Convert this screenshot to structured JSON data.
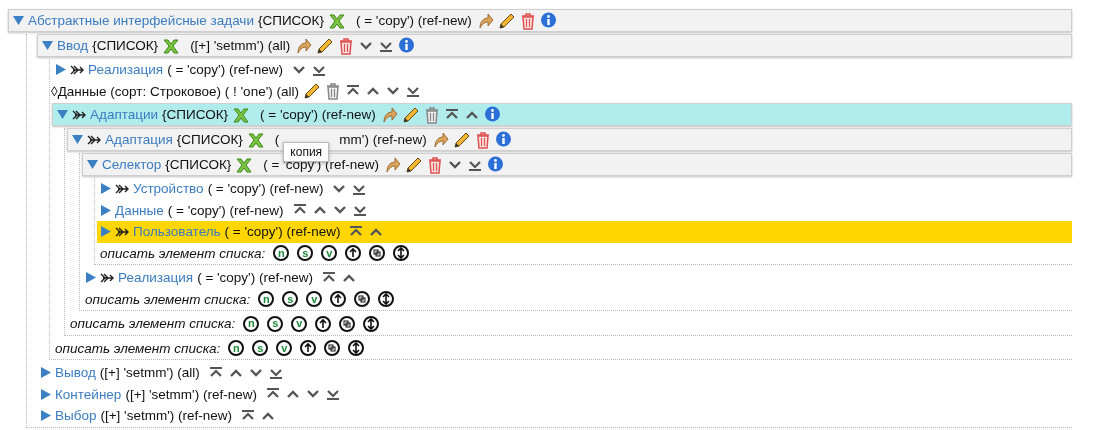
{
  "tree": {
    "kind": "list",
    "expanded": true,
    "linked": false,
    "name": "Абстрактные интерфейсные задачи",
    "tag": "{СПИСОК}",
    "qualifier": "( = 'copy') (ref-new)",
    "icons": [
      {
        "kind": "undo"
      },
      {
        "kind": "edit"
      },
      {
        "kind": "delete"
      },
      {
        "kind": "info"
      }
    ],
    "children": [
      {
        "kind": "list",
        "expanded": true,
        "linked": false,
        "name": "Ввод",
        "tag": "{СПИСОК}",
        "qualifier": "([+] 'setmm') (all)",
        "icons": [
          {
            "kind": "undo"
          },
          {
            "kind": "edit"
          },
          {
            "kind": "delete"
          },
          {
            "kind": "down"
          },
          {
            "kind": "bottom"
          },
          {
            "kind": "info"
          }
        ],
        "children": [
          {
            "kind": "item",
            "expanded": false,
            "linked": true,
            "name": "Реализация",
            "qualifier": "( = 'copy') (ref-new)",
            "icons": [
              {
                "kind": "down"
              },
              {
                "kind": "bottom"
              }
            ]
          },
          {
            "kind": "field",
            "marker": "◊",
            "name": "Данные (сорт: Строковое) ( ! 'one') (all)",
            "icons": [
              {
                "kind": "edit"
              },
              {
                "kind": "delete-off"
              },
              {
                "kind": "top"
              },
              {
                "kind": "up"
              },
              {
                "kind": "down"
              },
              {
                "kind": "bottom"
              }
            ]
          },
          {
            "kind": "list",
            "expanded": true,
            "linked": true,
            "color": "#b0ecec",
            "name": "Адаптации",
            "tag": "{СПИСОК}",
            "qualifier": "( = 'copy') (ref-new)",
            "icons": [
              {
                "kind": "undo"
              },
              {
                "kind": "edit"
              },
              {
                "kind": "delete-off"
              },
              {
                "kind": "top"
              },
              {
                "kind": "up"
              },
              {
                "kind": "info"
              }
            ],
            "children": [
              {
                "kind": "list",
                "expanded": true,
                "linked": true,
                "name": "Адаптация",
                "tag": "{СПИСОК}",
                "qualifier": "(",
                "qualifier_tail": "mm') (ref-new)",
                "tooltip": "копия",
                "icons": [
                  {
                    "kind": "undo"
                  },
                  {
                    "kind": "edit"
                  },
                  {
                    "kind": "delete"
                  },
                  {
                    "kind": "info"
                  }
                ],
                "children": [
                  {
                    "kind": "list",
                    "expanded": true,
                    "linked": false,
                    "name": "Селектор",
                    "tag": "{СПИСОК}",
                    "qualifier": "( = 'copy') (ref-new)",
                    "icons": [
                      {
                        "kind": "undo"
                      },
                      {
                        "kind": "edit"
                      },
                      {
                        "kind": "delete"
                      },
                      {
                        "kind": "down"
                      },
                      {
                        "kind": "bottom"
                      },
                      {
                        "kind": "info"
                      }
                    ],
                    "children": [
                      {
                        "kind": "item",
                        "expanded": false,
                        "linked": true,
                        "name": "Устройство",
                        "qualifier": "( = 'copy') (ref-new)",
                        "icons": [
                          {
                            "kind": "down"
                          },
                          {
                            "kind": "bottom"
                          }
                        ]
                      },
                      {
                        "kind": "item",
                        "expanded": false,
                        "linked": false,
                        "name": "Данные",
                        "qualifier": "( = 'copy') (ref-new)",
                        "icons": [
                          {
                            "kind": "top"
                          },
                          {
                            "kind": "up"
                          },
                          {
                            "kind": "down"
                          },
                          {
                            "kind": "bottom"
                          }
                        ]
                      },
                      {
                        "kind": "item",
                        "expanded": false,
                        "linked": true,
                        "color": "#ffd600",
                        "name": "Пользователь",
                        "qualifier": "( = 'copy') (ref-new)",
                        "icons": [
                          {
                            "kind": "top"
                          },
                          {
                            "kind": "up"
                          }
                        ]
                      },
                      {
                        "kind": "describe",
                        "label": "описать элемент списка:",
                        "buttons": [
                          {
                            "kind": "letter",
                            "text": "n"
                          },
                          {
                            "kind": "letter",
                            "text": "s"
                          },
                          {
                            "kind": "letter",
                            "text": "v"
                          },
                          {
                            "kind": "up"
                          },
                          {
                            "kind": "copy"
                          },
                          {
                            "kind": "updown"
                          }
                        ]
                      }
                    ]
                  },
                  {
                    "kind": "item",
                    "expanded": false,
                    "linked": true,
                    "name": "Реализация",
                    "qualifier": "( = 'copy') (ref-new)",
                    "icons": [
                      {
                        "kind": "top"
                      },
                      {
                        "kind": "up"
                      }
                    ]
                  },
                  {
                    "kind": "describe",
                    "label": "описать элемент списка:",
                    "buttons": [
                      {
                        "kind": "letter",
                        "text": "n"
                      },
                      {
                        "kind": "letter",
                        "text": "s"
                      },
                      {
                        "kind": "letter",
                        "text": "v"
                      },
                      {
                        "kind": "up"
                      },
                      {
                        "kind": "copy"
                      },
                      {
                        "kind": "updown"
                      }
                    ]
                  }
                ]
              },
              {
                "kind": "describe",
                "label": "описать элемент списка:",
                "buttons": [
                  {
                    "kind": "letter",
                    "text": "n"
                  },
                  {
                    "kind": "letter",
                    "text": "s"
                  },
                  {
                    "kind": "letter",
                    "text": "v"
                  },
                  {
                    "kind": "up"
                  },
                  {
                    "kind": "copy"
                  },
                  {
                    "kind": "updown"
                  }
                ]
              }
            ]
          },
          {
            "kind": "describe",
            "label": "описать элемент списка:",
            "buttons": [
              {
                "kind": "letter",
                "text": "n"
              },
              {
                "kind": "letter",
                "text": "s"
              },
              {
                "kind": "letter",
                "text": "v"
              },
              {
                "kind": "up"
              },
              {
                "kind": "copy"
              },
              {
                "kind": "updown"
              }
            ]
          }
        ]
      },
      {
        "kind": "item",
        "expanded": false,
        "linked": false,
        "name": "Вывод",
        "qualifier": "([+] 'setmm') (all)",
        "icons": [
          {
            "kind": "top"
          },
          {
            "kind": "up"
          },
          {
            "kind": "down"
          },
          {
            "kind": "bottom"
          }
        ]
      },
      {
        "kind": "item",
        "expanded": false,
        "linked": false,
        "name": "Контейнер",
        "qualifier": "([+] 'setmm') (ref-new)",
        "icons": [
          {
            "kind": "top"
          },
          {
            "kind": "up"
          },
          {
            "kind": "down"
          },
          {
            "kind": "bottom"
          }
        ]
      },
      {
        "kind": "item",
        "expanded": false,
        "linked": false,
        "name": "Выбор",
        "qualifier": "([+] 'setmm') (ref-new)",
        "icons": [
          {
            "kind": "top"
          },
          {
            "kind": "up"
          }
        ]
      }
    ]
  }
}
